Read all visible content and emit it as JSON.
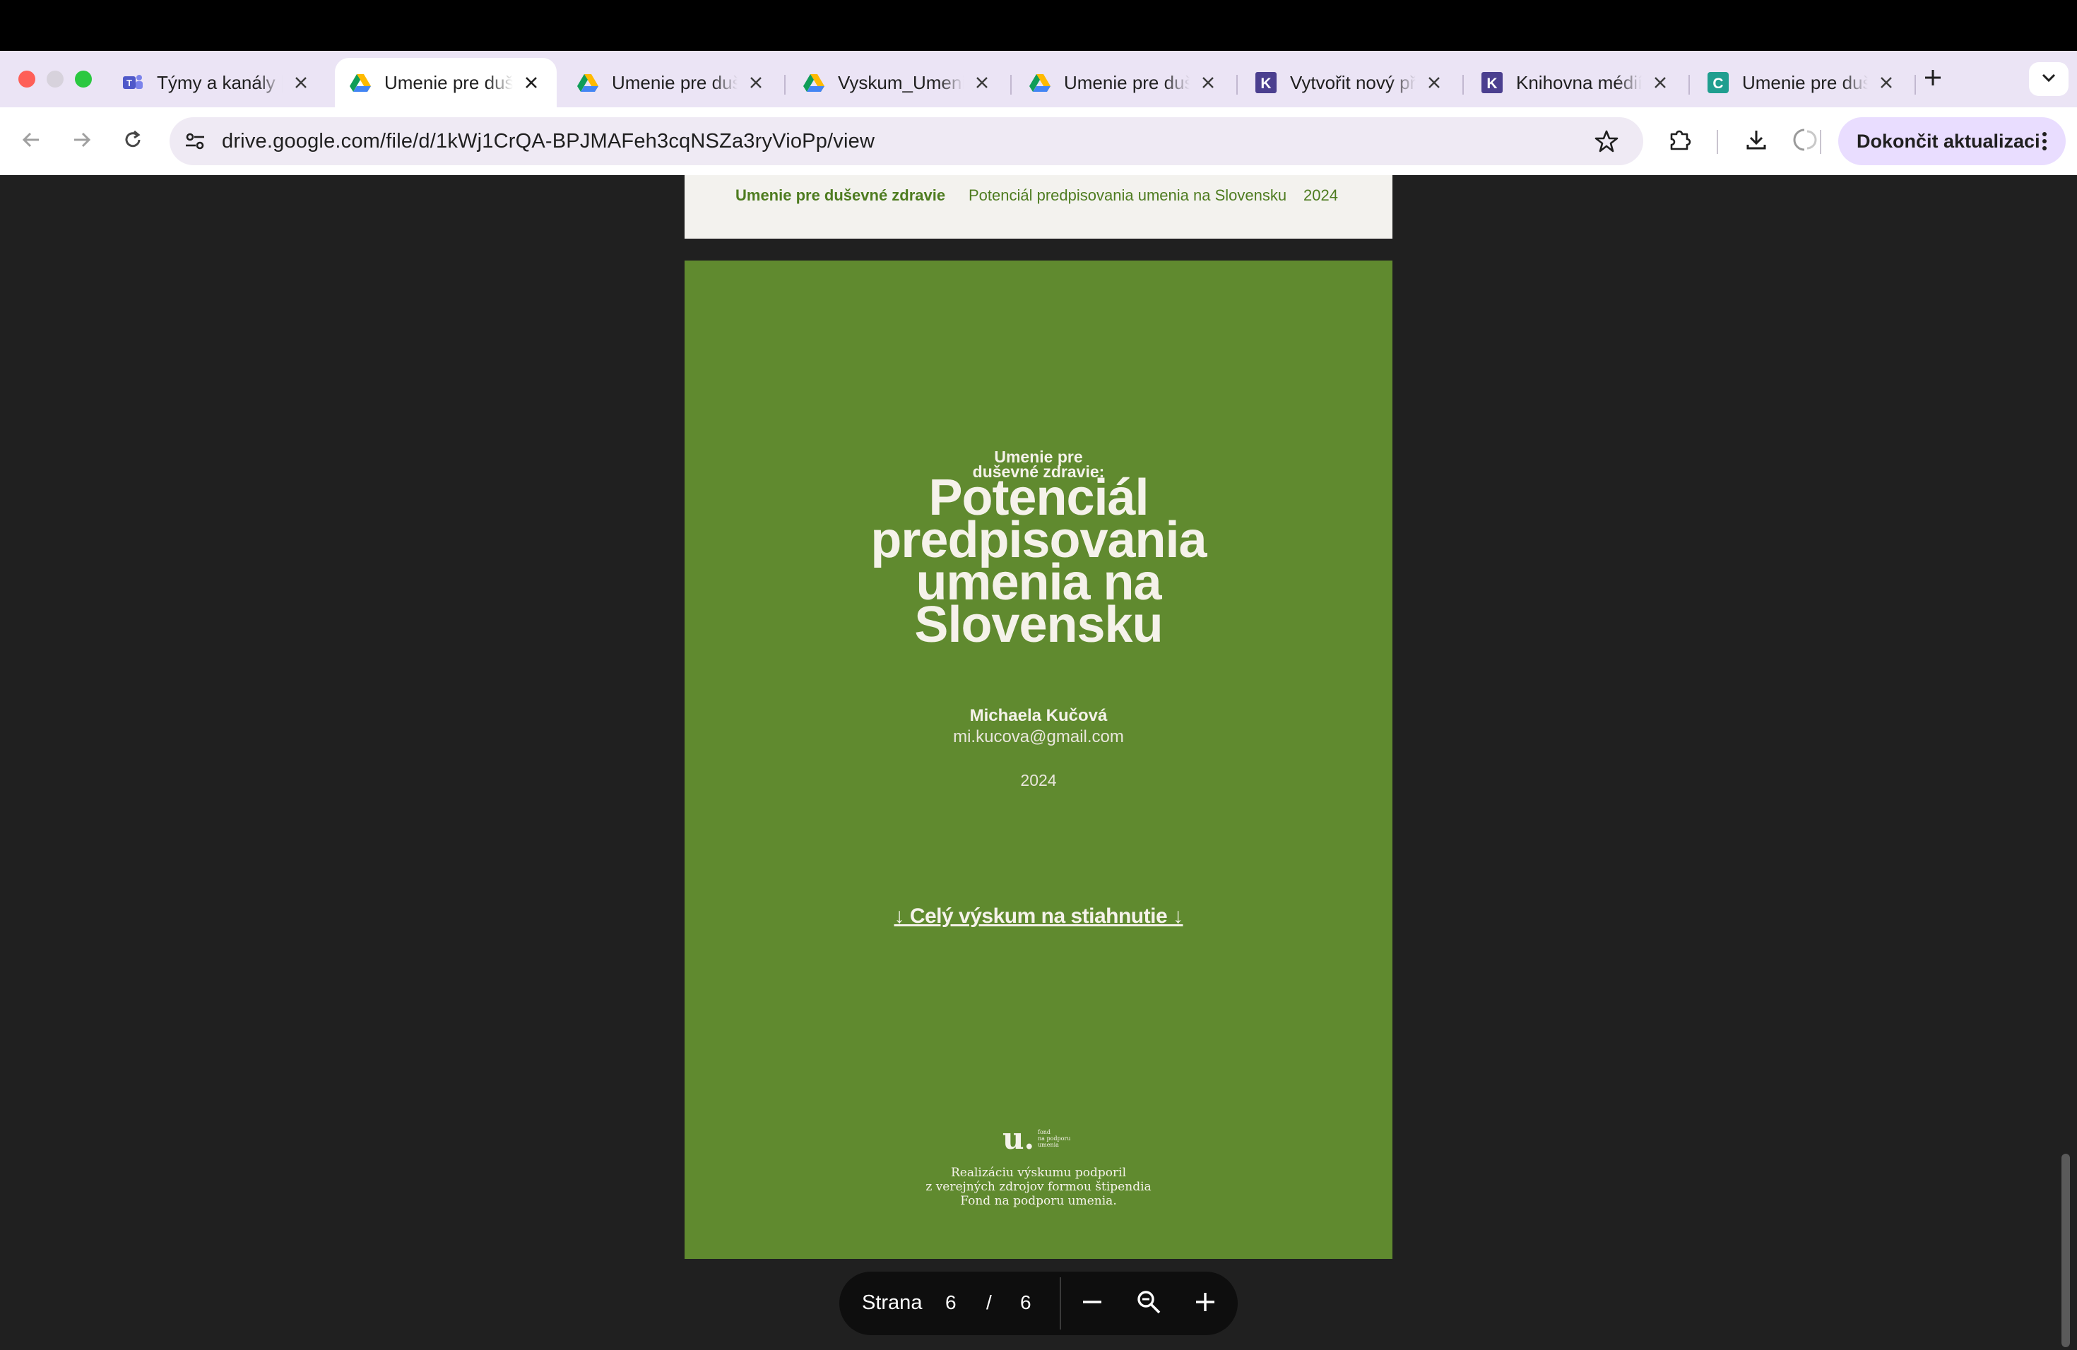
{
  "browser": {
    "tabs": [
      {
        "title": "Týmy a kanály | ",
        "icon": "teams-icon",
        "active": false
      },
      {
        "title": "Umenie pre duševné zdravie",
        "icon": "google-drive-icon",
        "active": true
      },
      {
        "title": "Umenie pre duševné zdravie",
        "icon": "google-drive-icon",
        "active": false
      },
      {
        "title": "Vyskum_Umenie",
        "icon": "google-drive-icon",
        "active": false
      },
      {
        "title": "Umenie pre duševné zdravie",
        "icon": "google-drive-icon",
        "active": false
      },
      {
        "title": "Vytvořit nový příspěvek",
        "icon": "k-app-icon",
        "active": false
      },
      {
        "title": "Knihovna médií",
        "icon": "k-app-icon",
        "active": false
      },
      {
        "title": "Umenie pre duševné zdravie",
        "icon": "canva-icon",
        "active": false
      }
    ],
    "url": "drive.google.com/file/d/1kWj1CrQA-BPJMAFeh3cqNSZa3ryVioPp/view",
    "update_button": "Dokončit aktualizaci",
    "colors": {
      "tabstrip": "#ebe4f5",
      "omnibox": "#efeaf4",
      "update": "#e9ddff"
    }
  },
  "page5_footer": {
    "left": "Umenie pre duševné zdravie",
    "middle": "Potenciál predpisovania umenia na Slovensku",
    "right": "2024"
  },
  "cover": {
    "subtitle_line1": "Umenie pre",
    "subtitle_line2": "duševné zdravie:",
    "title_line1": "Potenciál",
    "title_line2": "predpisovania",
    "title_line3": "umenia na",
    "title_line4": "Slovensku",
    "author": "Michaela Kučová",
    "email": "mi.kucova@gmail.com",
    "year": "2024",
    "download_link": "↓ Celý výskum na stiahnutie ↓",
    "logo_letter": "u.",
    "logo_text_1": "fond",
    "logo_text_2": "na podporu",
    "logo_text_3": "umenia",
    "support_line1": "Realizáciu výskumu podporil",
    "support_line2": "z verejných zdrojov formou štipendia",
    "support_line3": "Fond na podporu umenia.",
    "background": "#608a2f"
  },
  "pagination": {
    "label": "Strana",
    "current": "6",
    "separator": "/",
    "total": "6"
  }
}
